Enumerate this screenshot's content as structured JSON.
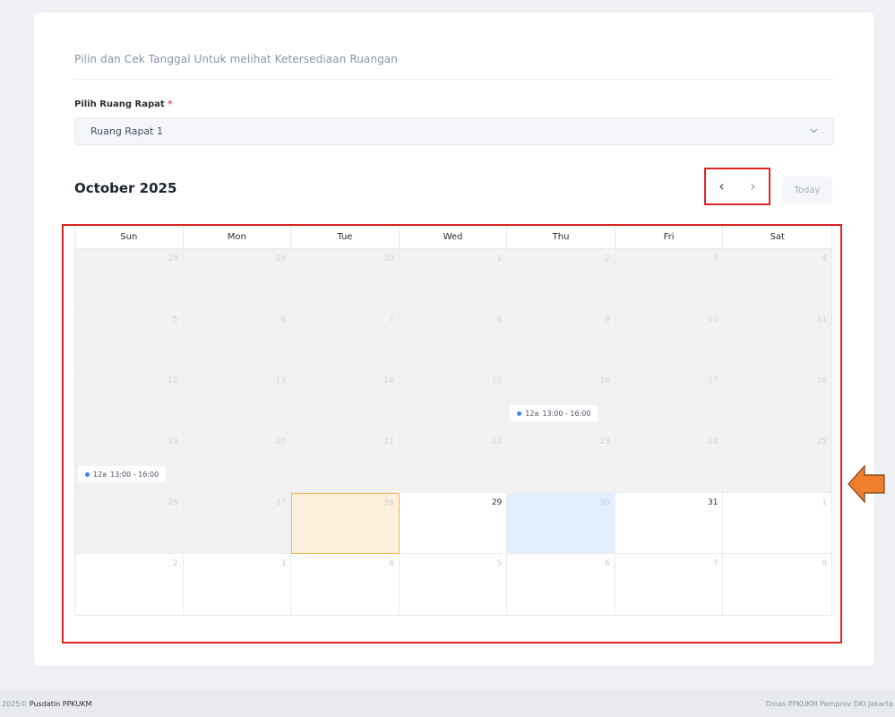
{
  "header": {
    "title": "Pilin dan Cek Tanggal Untuk melihat Ketersediaan Ruangan"
  },
  "room_field": {
    "label": "Pilih Ruang Rapat",
    "required_mark": "*",
    "value": "Ruang Rapat 1",
    "chevron_icon": "chevron-down-icon"
  },
  "calendar": {
    "month_title": "October 2025",
    "prev_icon": "‹",
    "next_icon": "›",
    "today_label": "Today",
    "weekdays": [
      "Sun",
      "Mon",
      "Tue",
      "Wed",
      "Thu",
      "Fri",
      "Sat"
    ],
    "weeks": [
      [
        {
          "day": "28",
          "state": "past"
        },
        {
          "day": "29",
          "state": "past"
        },
        {
          "day": "30",
          "state": "past"
        },
        {
          "day": "1",
          "state": "past"
        },
        {
          "day": "2",
          "state": "past"
        },
        {
          "day": "3",
          "state": "past"
        },
        {
          "day": "4",
          "state": "past"
        }
      ],
      [
        {
          "day": "5",
          "state": "past"
        },
        {
          "day": "6",
          "state": "past"
        },
        {
          "day": "7",
          "state": "past"
        },
        {
          "day": "8",
          "state": "past"
        },
        {
          "day": "9",
          "state": "past"
        },
        {
          "day": "10",
          "state": "past"
        },
        {
          "day": "11",
          "state": "past"
        }
      ],
      [
        {
          "day": "12",
          "state": "past"
        },
        {
          "day": "13",
          "state": "past"
        },
        {
          "day": "14",
          "state": "past"
        },
        {
          "day": "15",
          "state": "past"
        },
        {
          "day": "16",
          "state": "past"
        },
        {
          "day": "17",
          "state": "past"
        },
        {
          "day": "18",
          "state": "past"
        }
      ],
      [
        {
          "day": "19",
          "state": "past"
        },
        {
          "day": "20",
          "state": "past"
        },
        {
          "day": "21",
          "state": "past"
        },
        {
          "day": "22",
          "state": "past"
        },
        {
          "day": "23",
          "state": "past"
        },
        {
          "day": "24",
          "state": "past"
        },
        {
          "day": "25",
          "state": "past"
        }
      ],
      [
        {
          "day": "26",
          "state": "past"
        },
        {
          "day": "27",
          "state": "past"
        },
        {
          "day": "28",
          "state": "today"
        },
        {
          "day": "29",
          "state": "current"
        },
        {
          "day": "30",
          "state": "selected"
        },
        {
          "day": "31",
          "state": "current"
        },
        {
          "day": "1",
          "state": "other"
        }
      ],
      [
        {
          "day": "2",
          "state": "other"
        },
        {
          "day": "3",
          "state": "other"
        },
        {
          "day": "4",
          "state": "other"
        },
        {
          "day": "5",
          "state": "other"
        },
        {
          "day": "6",
          "state": "other"
        },
        {
          "day": "7",
          "state": "other"
        },
        {
          "day": "8",
          "state": "other"
        }
      ]
    ],
    "events": [
      {
        "week": 2,
        "weekday": 4,
        "label": "12a",
        "time": "13:00 - 16:00"
      },
      {
        "week": 3,
        "weekday": 0,
        "label": "12a",
        "time": "13:00 - 16:00"
      }
    ],
    "event_dot_color": "#3b82f6"
  },
  "footer": {
    "copyright": "2025©",
    "brand": "Pusdatin PPKUKM",
    "right_text": "Dinas PPKUKM Pemprov DKI Jakarta"
  }
}
